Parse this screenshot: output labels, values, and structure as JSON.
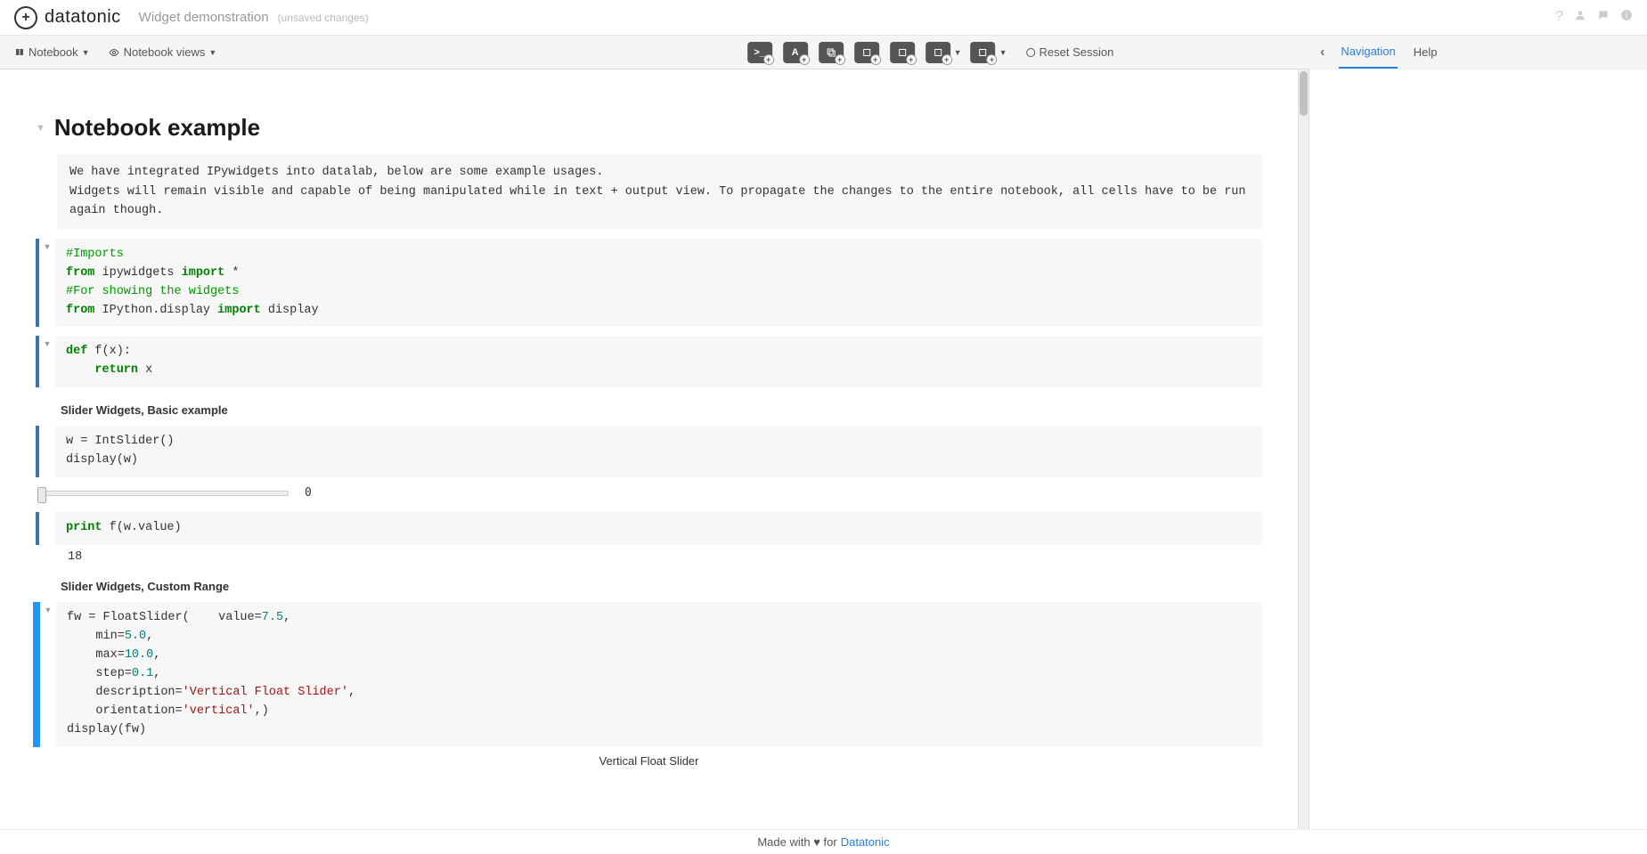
{
  "header": {
    "brand": "datatonic",
    "doc_title": "Widget demonstration",
    "status": "(unsaved changes)"
  },
  "toolbar": {
    "notebook_menu": "Notebook",
    "views_menu": "Notebook views",
    "reset": "Reset Session"
  },
  "right_panel": {
    "tab_nav": "Navigation",
    "tab_help": "Help"
  },
  "notebook": {
    "title": "Notebook example",
    "intro": "We have integrated IPywidgets into datalab, below are some example usages.\nWidgets will remain visible and capable of being manipulated while in text + output view. To propagate the changes to the entire notebook, all cells have to be run again though.",
    "code_imports": {
      "c1": "#Imports",
      "c2a": "from",
      "c2b": " ipywidgets ",
      "c2c": "import",
      "c2d": " *",
      "c3": "#For showing the widgets",
      "c4a": "from",
      "c4b": " IPython.display ",
      "c4c": "import",
      "c4d": " display"
    },
    "code_def": {
      "l1a": "def",
      "l1b": " f(x):",
      "l2a": "    ",
      "l2b": "return",
      "l2c": " x"
    },
    "sub1": "Slider Widgets, Basic example",
    "code_slider1": "w = IntSlider()\ndisplay(w)",
    "slider_output_value": "0",
    "code_print": {
      "a": "print",
      "b": " f(w.value)"
    },
    "print_output": "18",
    "sub2": "Slider Widgets, Custom Range",
    "code_float": {
      "l1": "fw = FloatSlider(    value=",
      "l1n": "7.5",
      "l1e": ",",
      "l2a": "    min=",
      "l2n": "5.0",
      "l2e": ",",
      "l3a": "    max=",
      "l3n": "10.0",
      "l3e": ",",
      "l4a": "    step=",
      "l4n": "0.1",
      "l4e": ",",
      "l5a": "    description=",
      "l5s": "'Vertical Float Slider'",
      "l5e": ",",
      "l6a": "    orientation=",
      "l6s": "'vertical'",
      "l6e": ",)",
      "l7": "display(fw)"
    },
    "float_label": "Vertical Float Slider"
  },
  "footer": {
    "pre": "Made with ♥ for ",
    "link": "Datatonic"
  }
}
